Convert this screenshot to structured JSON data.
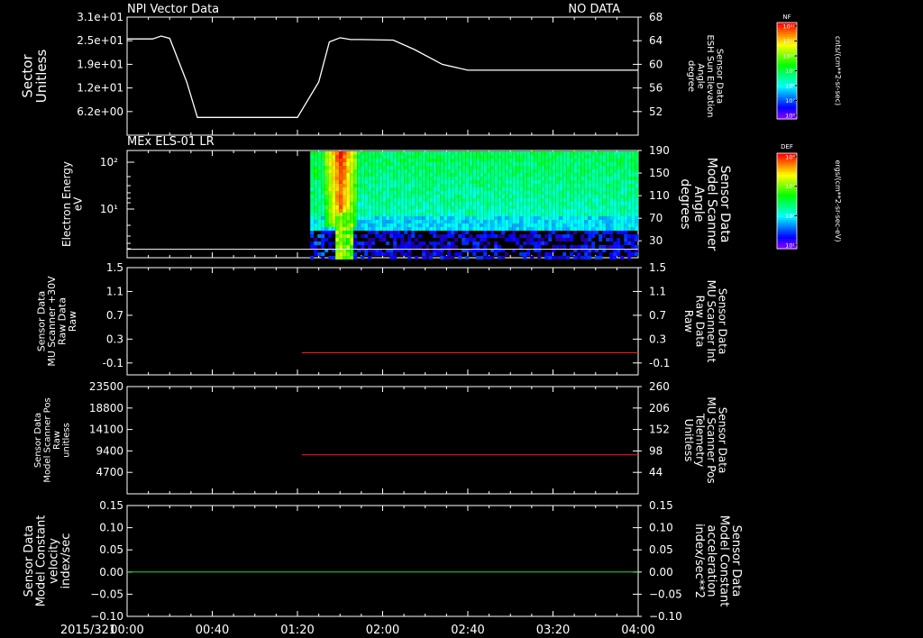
{
  "header": {
    "title_left": "NPI Vector Data",
    "title_right": "NO DATA",
    "date_label": "2015/321"
  },
  "colors": {
    "frame": "#ffffff",
    "red_series": "#ff2020",
    "green_series": "#22dd22",
    "background": "#000000"
  },
  "time_axis": {
    "ticks": [
      "00:00",
      "00:40",
      "01:20",
      "02:00",
      "02:40",
      "03:20",
      "04:00"
    ],
    "range_minutes": [
      0,
      240
    ]
  },
  "chart_data": [
    {
      "type": "line",
      "panel": "sector",
      "ylabel_left": [
        "Sector",
        "Unitless"
      ],
      "ylabel_right": [
        "Sensor Data",
        "ESH Sun Elevation",
        "Angle",
        "degree"
      ],
      "yticks_left": [
        "3.1e+01",
        "2.5e+01",
        "1.9e+01",
        "1.2e+01",
        "6.2e+00"
      ],
      "yticks_right": [
        "68",
        "64",
        "60",
        "56",
        "52"
      ],
      "ylim_right": [
        48,
        68
      ],
      "x_minutes": [
        0,
        12,
        16,
        20,
        28,
        33,
        50,
        80,
        90,
        95,
        100,
        105,
        110,
        125,
        135,
        148,
        160,
        240
      ],
      "y_degree": [
        64.3,
        64.3,
        64.8,
        64.4,
        57,
        51,
        51,
        51,
        57,
        63.8,
        64.5,
        64.2,
        64.2,
        64.1,
        62.5,
        60,
        59,
        59
      ]
    },
    {
      "type": "heatmap",
      "panel": "spectrogram",
      "title": "MEx ELS-01 LR",
      "ylabel_left": [
        "Electron Energy",
        "eV"
      ],
      "ylabel_right": [
        "Sensor Data",
        "Model Scanner",
        "Angle",
        "degrees"
      ],
      "yticks_left": [
        "10²",
        "10¹"
      ],
      "yticks_right": [
        "190",
        "150",
        "110",
        "70",
        "30"
      ],
      "ylim_right": [
        0,
        190
      ],
      "data_start_minutes": 86,
      "burst_minutes": [
        92,
        107
      ],
      "line_right_value": 15,
      "colorbar": {
        "label": "DEF",
        "ticks": [
          "10⁴",
          "10³",
          "10²",
          "10¹"
        ],
        "unit": "ergs/(cm**2-sr-sec-eV)"
      }
    },
    {
      "type": "line",
      "panel": "mu-scanner-raw",
      "ylabel_left": [
        "Sensor Data",
        "MU Scanner +30V",
        "Raw Data",
        "Raw"
      ],
      "ylabel_right": [
        "Sensor Data",
        "MU Scanner Int",
        "Raw Data",
        "Raw"
      ],
      "yticks_left": [
        "1.5",
        "1.1",
        "0.7",
        "0.3",
        "-0.1"
      ],
      "yticks_right": [
        "1.5",
        "1.1",
        "0.7",
        "0.3",
        "-0.1"
      ],
      "ylim": [
        -0.3,
        1.5
      ],
      "series": [
        {
          "x_minutes": [
            82,
            240
          ],
          "values": [
            0.07,
            0.07
          ]
        }
      ]
    },
    {
      "type": "line",
      "panel": "scanner-pos",
      "ylabel_left": [
        "Sensor Data",
        "Model Scanner Pos",
        "Raw",
        "unitless"
      ],
      "ylabel_right": [
        "Sensor Data",
        "MU Scanner Pos",
        "Telemetry",
        "Unitless"
      ],
      "yticks_left": [
        "23500",
        "18800",
        "14100",
        "9400",
        "4700"
      ],
      "yticks_right": [
        "260",
        "206",
        "152",
        "98",
        "44"
      ],
      "ylim_right": [
        -10,
        260
      ],
      "series": [
        {
          "x_minutes": [
            82,
            240
          ],
          "values": [
            88,
            88
          ]
        }
      ]
    },
    {
      "type": "line",
      "panel": "velocity",
      "ylabel_left": [
        "Sensor Data",
        "Model Constant",
        "velocity",
        "index/sec"
      ],
      "ylabel_right": [
        "Sensor Data",
        "Model Constant",
        "acceleration",
        "index/sec**2"
      ],
      "yticks_left": [
        "0.15",
        "0.10",
        "0.05",
        "0.00",
        "−0.05",
        "−0.10"
      ],
      "yticks_right": [
        "0.15",
        "0.10",
        "0.05",
        "0.00",
        "−0.05",
        "−0.10"
      ],
      "ylim": [
        -0.1,
        0.15
      ],
      "series": [
        {
          "x_minutes": [
            0,
            240
          ],
          "values": [
            0.0,
            0.0
          ]
        }
      ]
    }
  ],
  "colorbar_nf": {
    "label": "NF",
    "ticks": [
      "10¹²",
      "10¹¹",
      "10¹⁰",
      "10⁹",
      "10⁸",
      "10⁷",
      "10⁶"
    ],
    "unit": "cnts/(cm**2-sr-sec)"
  }
}
